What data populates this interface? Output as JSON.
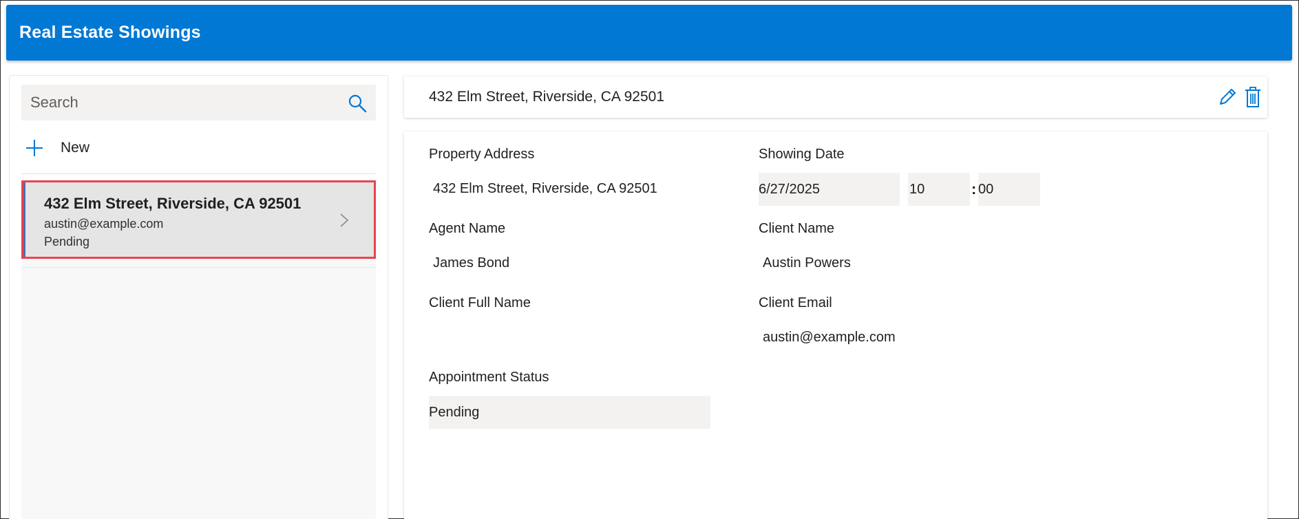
{
  "header": {
    "title": "Real Estate Showings"
  },
  "search": {
    "placeholder": "Search"
  },
  "new_button": {
    "label": "New"
  },
  "gallery": {
    "items": [
      {
        "title": "432 Elm Street, Riverside, CA 92501",
        "email": "austin@example.com",
        "status": "Pending"
      }
    ]
  },
  "detail": {
    "title": "432 Elm Street, Riverside, CA 92501",
    "fields": {
      "property_address": {
        "label": "Property Address",
        "value": "432 Elm Street, Riverside, CA 92501"
      },
      "showing_date": {
        "label": "Showing Date",
        "date": "6/27/2025",
        "hour": "10",
        "separator": ":",
        "minute": "00"
      },
      "agent_name": {
        "label": "Agent Name",
        "value": "James Bond"
      },
      "client_name": {
        "label": "Client Name",
        "value": "Austin Powers"
      },
      "client_full_name": {
        "label": "Client Full Name",
        "value": ""
      },
      "client_email": {
        "label": "Client Email",
        "value": "austin@example.com"
      },
      "appointment_status": {
        "label": "Appointment Status",
        "value": "Pending"
      }
    }
  },
  "colors": {
    "header_blue": "#0078d4",
    "selection_border": "#e8434f",
    "accent_bar": "#4d6fae",
    "input_bg": "#f3f2f1"
  },
  "icons": [
    "search-icon",
    "plus-icon",
    "chevron-right-icon",
    "edit-icon",
    "trash-icon"
  ]
}
